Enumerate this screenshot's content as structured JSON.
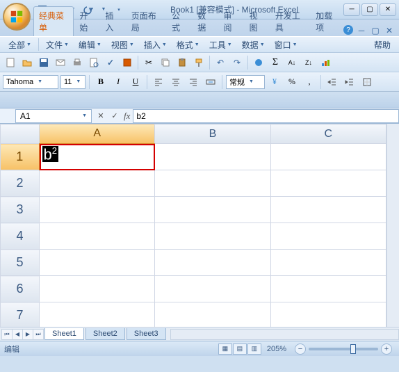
{
  "title": "Book1  [兼容模式] - Microsoft Excel",
  "ribbon": {
    "tabs": [
      "经典菜单",
      "开始",
      "插入",
      "页面布局",
      "公式",
      "数据",
      "审阅",
      "视图",
      "开发工具",
      "加载项"
    ],
    "active": 0
  },
  "classic_menu": {
    "all": "全部",
    "file": "文件",
    "edit": "编辑",
    "view": "视图",
    "insert": "插入",
    "format": "格式",
    "tools": "工具",
    "data": "数据",
    "window": "窗口",
    "help": "帮助"
  },
  "format": {
    "font": "Tahoma",
    "size": "11",
    "style_box": "常规"
  },
  "namebox": "A1",
  "formula": "b2",
  "cols": [
    "A",
    "B",
    "C"
  ],
  "rows": [
    "1",
    "2",
    "3",
    "4",
    "5",
    "6",
    "7"
  ],
  "cell_edit": {
    "base": "b",
    "sup": "2"
  },
  "sheets": [
    "Sheet1",
    "Sheet2",
    "Sheet3"
  ],
  "status": {
    "mode": "编辑",
    "zoom": "205%"
  }
}
